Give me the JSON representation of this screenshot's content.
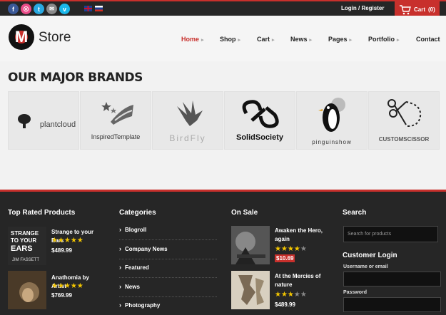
{
  "topbar": {
    "social": [
      {
        "icon": "facebook-icon",
        "glyph": "f",
        "color": "#3b5998"
      },
      {
        "icon": "dribbble-icon",
        "glyph": "◎",
        "color": "#ea4c89"
      },
      {
        "icon": "twitter-icon",
        "glyph": "t",
        "color": "#29a9e1"
      },
      {
        "icon": "email-icon",
        "glyph": "✉",
        "color": "#8a8a8a"
      },
      {
        "icon": "vimeo-icon",
        "glyph": "v",
        "color": "#1ab7ea"
      }
    ],
    "flags": [
      "flag-uk-icon",
      "flag-ru-icon"
    ],
    "login_label": "Login / Register",
    "cart_label": "Cart",
    "cart_count": "(0)"
  },
  "header": {
    "logo_letter": "M",
    "logo_text": "Store",
    "nav": [
      {
        "label": "Home",
        "active": true
      },
      {
        "label": "Shop"
      },
      {
        "label": "Cart"
      },
      {
        "label": "News"
      },
      {
        "label": "Pages"
      },
      {
        "label": "Portfolio"
      },
      {
        "label": "Contact"
      }
    ]
  },
  "brands": {
    "title": "OUR MAJOR BRANDS",
    "items": [
      "plantcloud",
      "InspiredTemplate",
      "BirdFly",
      "SolidSociety",
      "pinguinshow",
      "CUSTOMSCISSOR"
    ]
  },
  "footer": {
    "top_rated": {
      "title": "Top Rated Products",
      "products": [
        {
          "name": "Strange to your Ears",
          "rating": 5,
          "price": "$489.99",
          "thumb_text": "STRANGE TO YOUR EARS",
          "thumb_sub": "JIM FASSETT"
        },
        {
          "name": "Anathomia by Artist",
          "rating": 5,
          "price": "$769.99"
        }
      ]
    },
    "categories": {
      "title": "Categories",
      "items": [
        "Blogroll",
        "Company News",
        "Featured",
        "News",
        "Photography"
      ]
    },
    "on_sale": {
      "title": "On Sale",
      "products": [
        {
          "name": "Awaken the Hero, again",
          "rating": 4,
          "price": "$10.69"
        },
        {
          "name": "At the Mercies of nature",
          "rating": 3,
          "price": "$489.99"
        }
      ]
    },
    "search": {
      "title": "Search",
      "placeholder": "Search for products"
    },
    "login": {
      "title": "Customer Login",
      "username_label": "Username or email",
      "password_label": "Password"
    }
  },
  "colors": {
    "accent": "#c8302c",
    "dark": "#262626",
    "star": "#f2c500"
  }
}
